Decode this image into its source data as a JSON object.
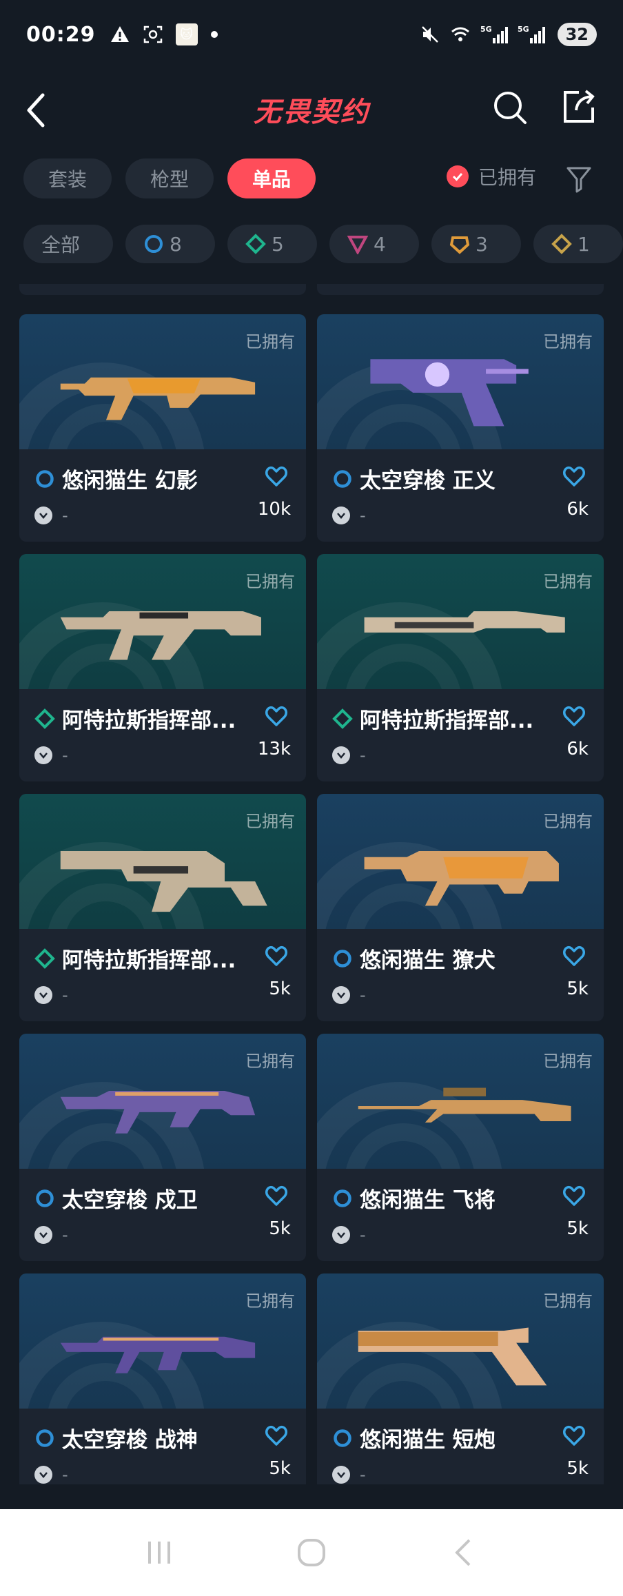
{
  "status_bar": {
    "time": "00:29",
    "battery": "32"
  },
  "header": {
    "title": "无畏契约"
  },
  "tabs": [
    {
      "label": "套装",
      "active": false
    },
    {
      "label": "枪型",
      "active": false
    },
    {
      "label": "单品",
      "active": true
    }
  ],
  "owned_filter": {
    "label": "已拥有",
    "checked": true
  },
  "rarity_chips": [
    {
      "label": "全部",
      "icon": null
    },
    {
      "label": "8",
      "icon": "circle-tier-icon",
      "color": "#2e8fd6"
    },
    {
      "label": "5",
      "icon": "diamond-tier-icon",
      "color": "#1fb58e"
    },
    {
      "label": "4",
      "icon": "triangle-tier-icon",
      "color": "#c0467f"
    },
    {
      "label": "3",
      "icon": "pentagon-tier-icon",
      "color": "#e09b3a"
    },
    {
      "label": "1",
      "icon": "diamond-gold-tier-icon",
      "color": "#c7a34a"
    }
  ],
  "cards": [
    {
      "name": "悠闲猫生 幻影",
      "tier": "circle",
      "likes": "10k",
      "meta": "-",
      "owned": "已拥有",
      "bg": "blue",
      "gun": "rifle-cat"
    },
    {
      "name": "太空穿梭 正义",
      "tier": "circle",
      "likes": "6k",
      "meta": "-",
      "owned": "已拥有",
      "bg": "blue",
      "gun": "revolver"
    },
    {
      "name": "阿特拉斯指挥部...",
      "tier": "diamond",
      "likes": "13k",
      "meta": "-",
      "owned": "已拥有",
      "bg": "teal",
      "gun": "rifle-tan"
    },
    {
      "name": "阿特拉斯指挥部...",
      "tier": "diamond",
      "likes": "6k",
      "meta": "-",
      "owned": "已拥有",
      "bg": "teal",
      "gun": "shotgun-tan"
    },
    {
      "name": "阿特拉斯指挥部...",
      "tier": "diamond",
      "likes": "5k",
      "meta": "-",
      "owned": "已拥有",
      "bg": "teal",
      "gun": "smg-tan"
    },
    {
      "name": "悠闲猫生 獠犬",
      "tier": "circle",
      "likes": "5k",
      "meta": "-",
      "owned": "已拥有",
      "bg": "blue",
      "gun": "bullpup-cat"
    },
    {
      "name": "太空穿梭 戍卫",
      "tier": "circle",
      "likes": "5k",
      "meta": "-",
      "owned": "已拥有",
      "bg": "blue",
      "gun": "rifle-space"
    },
    {
      "name": "悠闲猫生 飞将",
      "tier": "circle",
      "likes": "5k",
      "meta": "-",
      "owned": "已拥有",
      "bg": "blue",
      "gun": "sniper-cat"
    },
    {
      "name": "太空穿梭 战神",
      "tier": "circle",
      "likes": "5k",
      "meta": "-",
      "owned": "已拥有",
      "bg": "blue",
      "gun": "lmg-space"
    },
    {
      "name": "悠闲猫生 短炮",
      "tier": "circle",
      "likes": "5k",
      "meta": "-",
      "owned": "已拥有",
      "bg": "blue",
      "gun": "shorty-cat"
    }
  ],
  "colors": {
    "accent": "#ff4d5a",
    "background": "#141b24",
    "card": "#1c2430",
    "heart": "#3aa7e6"
  }
}
